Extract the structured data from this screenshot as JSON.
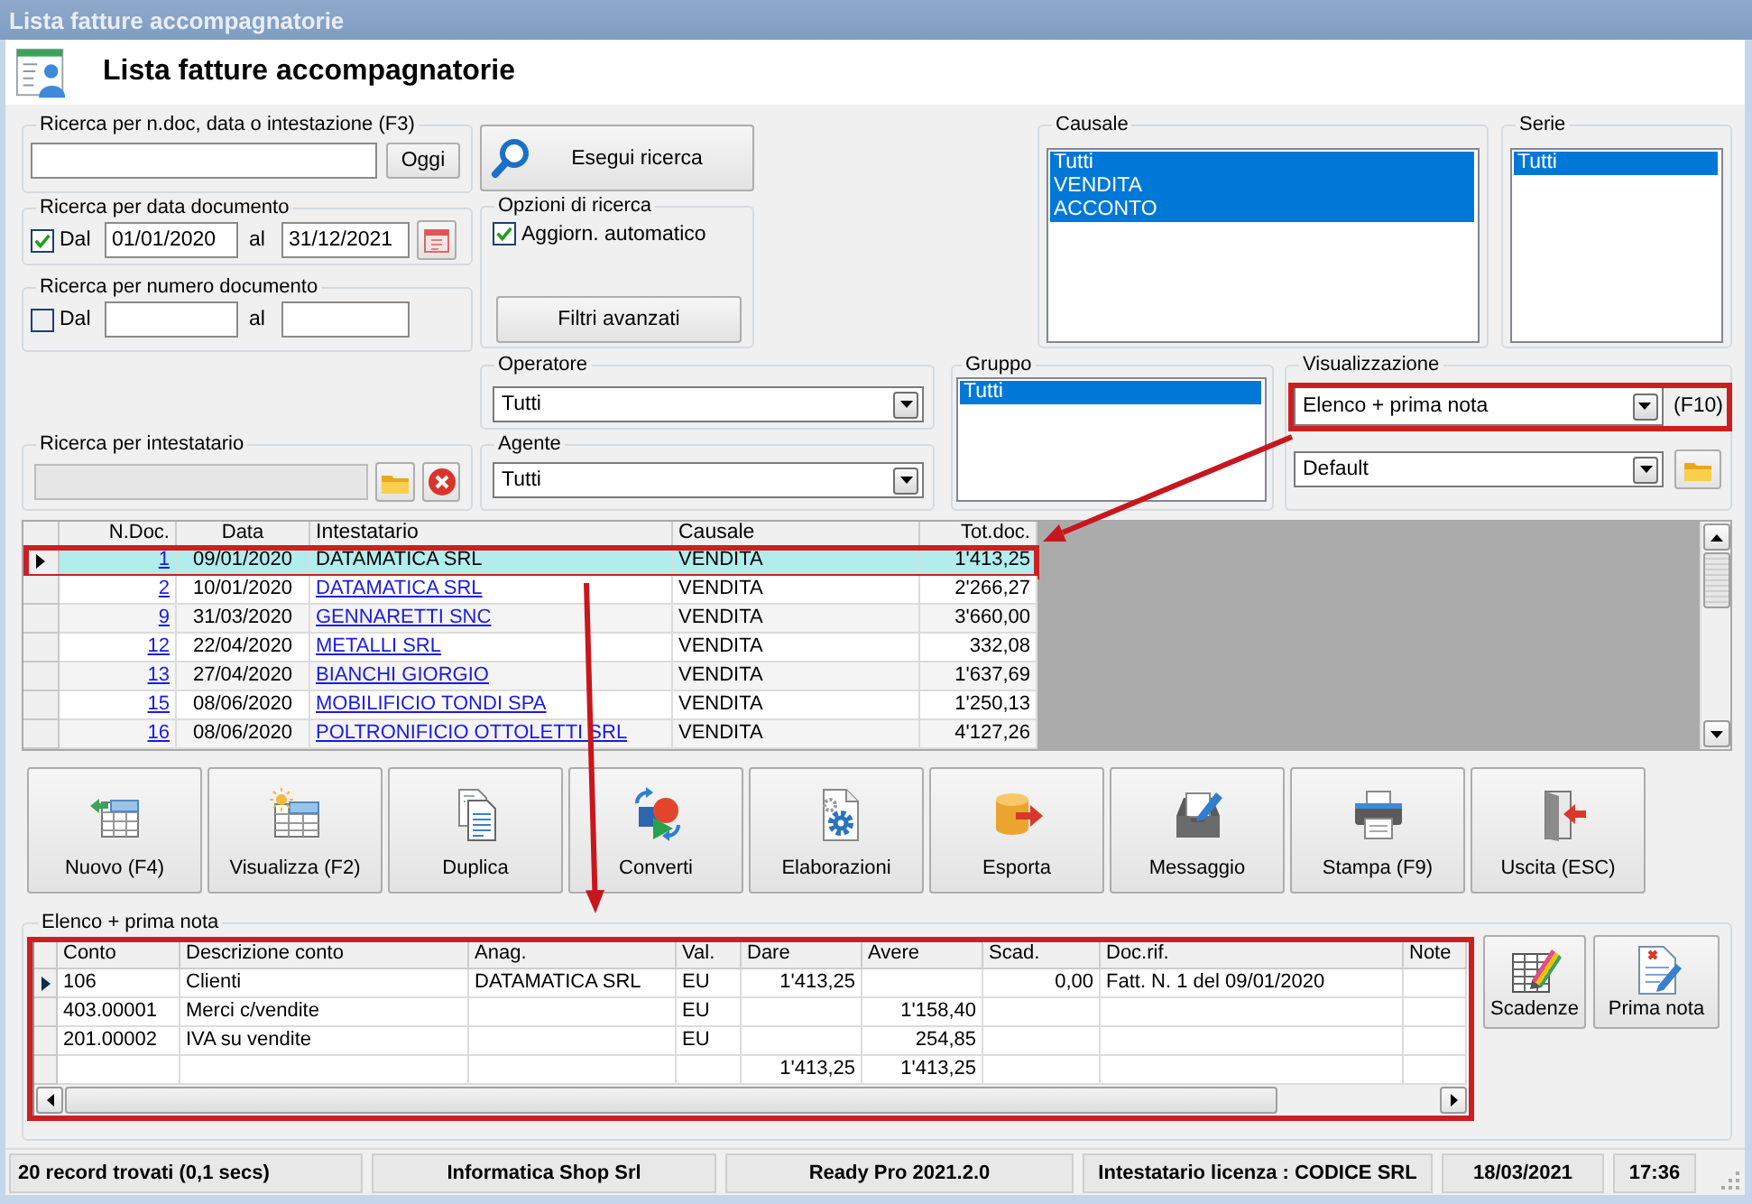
{
  "window": {
    "title": "Lista fatture accompagnatorie"
  },
  "header": {
    "title": "Lista fatture accompagnatorie"
  },
  "quick_search": {
    "label": "Ricerca per n.doc, data o intestazione (F3)",
    "button": "Oggi"
  },
  "date_search": {
    "label": "Ricerca per data documento",
    "checkbox": {
      "label": "Dal",
      "checked": true
    },
    "from": "01/01/2020",
    "to_label": "al",
    "to": "31/12/2021"
  },
  "number_search": {
    "label": "Ricerca per numero documento",
    "checkbox": {
      "label": "Dal",
      "checked": false
    },
    "to_label": "al"
  },
  "holder_search": {
    "label": "Ricerca per intestatario",
    "disabled": true
  },
  "search_button": {
    "label": "Esegui ricerca"
  },
  "search_options": {
    "label": "Opzioni di ricerca",
    "auto_update": {
      "label": "Aggiorn. automatico",
      "checked": true
    },
    "advanced_button": "Filtri avanzati"
  },
  "causale": {
    "label": "Causale",
    "items": [
      {
        "label": "Tutti",
        "selected": true
      },
      {
        "label": "VENDITA",
        "selected": true
      },
      {
        "label": "ACCONTO",
        "selected": true
      }
    ]
  },
  "serie": {
    "label": "Serie",
    "items": [
      {
        "label": "Tutti",
        "selected": true
      }
    ]
  },
  "operator": {
    "label": "Operatore",
    "value": "Tutti"
  },
  "agent": {
    "label": "Agente",
    "value": "Tutti"
  },
  "group": {
    "label": "Gruppo",
    "items": [
      {
        "label": "Tutti",
        "selected": true
      }
    ]
  },
  "view": {
    "label": "Visualizzazione",
    "mode": "Elenco + prima nota",
    "highlighted": true,
    "shortcut": "(F10)",
    "layout": "Default"
  },
  "documents": {
    "columns": {
      "number": "N.Doc.",
      "date": "Data",
      "holder": "Intestatario",
      "causale": "Causale",
      "total": "Tot.doc."
    },
    "rows": [
      {
        "number": "1",
        "date": "09/01/2020",
        "holder": "DATAMATICA SRL",
        "causale": "VENDITA",
        "total": "1'413,25",
        "selected": true,
        "highlighted": true
      },
      {
        "number": "2",
        "date": "10/01/2020",
        "holder": "DATAMATICA SRL",
        "causale": "VENDITA",
        "total": "2'266,27",
        "selected": false,
        "highlighted": false
      },
      {
        "number": "9",
        "date": "31/03/2020",
        "holder": "GENNARETTI SNC",
        "causale": "VENDITA",
        "total": "3'660,00",
        "selected": false,
        "highlighted": false
      },
      {
        "number": "12",
        "date": "22/04/2020",
        "holder": "METALLI SRL",
        "causale": "VENDITA",
        "total": "332,08",
        "selected": false,
        "highlighted": false
      },
      {
        "number": "13",
        "date": "27/04/2020",
        "holder": "BIANCHI GIORGIO",
        "causale": "VENDITA",
        "total": "1'637,69",
        "selected": false,
        "highlighted": false
      },
      {
        "number": "15",
        "date": "08/06/2020",
        "holder": "MOBILIFICIO TONDI SPA",
        "causale": "VENDITA",
        "total": "1'250,13",
        "selected": false,
        "highlighted": false
      },
      {
        "number": "16",
        "date": "08/06/2020",
        "holder": "POLTRONIFICIO OTTOLETTI SRL",
        "causale": "VENDITA",
        "total": "4'127,26",
        "selected": false,
        "highlighted": false
      }
    ]
  },
  "actions": [
    "Nuovo (F4)",
    "Visualizza (F2)",
    "Duplica",
    "Converti",
    "Elaborazioni",
    "Esporta",
    "Messaggio",
    "Stampa (F9)",
    "Uscita (ESC)"
  ],
  "journal": {
    "label": "Elenco + prima nota",
    "highlighted": true,
    "columns": {
      "conto": "Conto",
      "descrizione": "Descrizione conto",
      "anag": "Anag.",
      "val": "Val.",
      "dare": "Dare",
      "avere": "Avere",
      "scad": "Scad.",
      "doc_rif": "Doc.rif.",
      "note": "Note"
    },
    "rows": [
      {
        "conto": "106",
        "descrizione": "Clienti",
        "anag": "DATAMATICA SRL",
        "val": "EU",
        "dare": "1'413,25",
        "scad": "0,00",
        "doc_rif": "Fatt. N. 1 del 09/01/2020",
        "selected": true
      },
      {
        "conto": "403.00001",
        "descrizione": "Merci c/vendite",
        "val": "EU",
        "avere": "1'158,40",
        "selected": false
      },
      {
        "conto": "201.00002",
        "descrizione": "IVA su vendite",
        "val": "EU",
        "avere": "254,85",
        "selected": false
      }
    ],
    "totals": {
      "dare": "1'413,25",
      "avere": "1'413,25"
    }
  },
  "journal_buttons": [
    "Scadenze",
    "Prima nota"
  ],
  "status_bar": [
    "20 record trovati (0,1 secs)",
    "Informatica Shop Srl",
    "Ready Pro 2021.2.0",
    "Intestatario licenza : CODICE SRL",
    "18/03/2021",
    "17:36"
  ]
}
